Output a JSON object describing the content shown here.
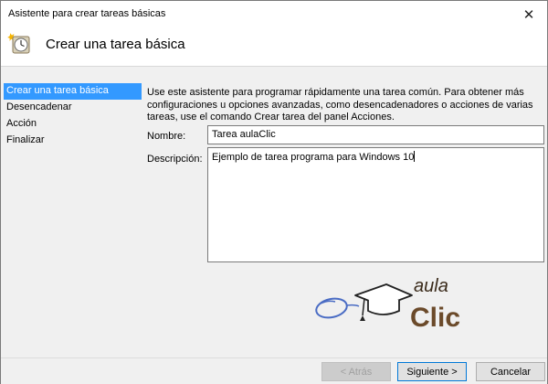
{
  "window": {
    "title": "Asistente para crear tareas básicas",
    "close_glyph": "✕"
  },
  "header": {
    "heading": "Crear una tarea básica",
    "icon": "task-scheduler-clock-icon"
  },
  "steps": [
    {
      "label": "Crear una tarea básica",
      "active": true
    },
    {
      "label": "Desencadenar",
      "active": false
    },
    {
      "label": "Acción",
      "active": false
    },
    {
      "label": "Finalizar",
      "active": false
    }
  ],
  "main": {
    "intro": "Use este asistente para programar rápidamente una tarea común. Para obtener más configuraciones u opciones avanzadas, como desencadenadores o acciones de varias tareas, use el comando Crear tarea del panel Acciones.",
    "name_label": "Nombre:",
    "name_value": "Tarea aulaClic",
    "description_label": "Descripción:",
    "description_value": "Ejemplo de tarea programa para Windows 10"
  },
  "logo": {
    "word_top": "aula",
    "word_bottom": "Clic"
  },
  "buttons": {
    "back": "< Atrás",
    "next": "Siguiente >",
    "cancel": "Cancelar"
  },
  "colors": {
    "selection": "#3399ff",
    "panel_bg": "#f0f0f0",
    "logo_dark": "#3a2a1a",
    "logo_brown": "#6b4a2a",
    "primary_border": "#0078d7"
  }
}
